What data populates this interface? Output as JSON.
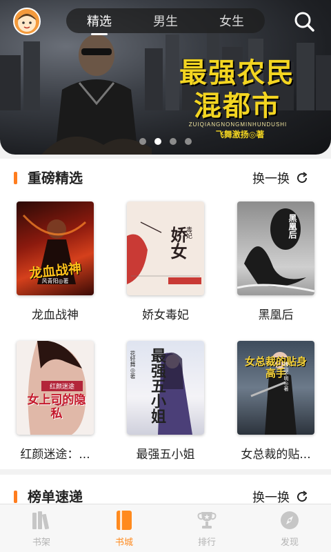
{
  "header": {
    "tabs": [
      {
        "label": "精选",
        "active": true
      },
      {
        "label": "男生",
        "active": false
      },
      {
        "label": "女生",
        "active": false
      }
    ]
  },
  "banner": {
    "title_line1": "最强农民",
    "title_line2": "混都市",
    "pinyin": "ZUIQIANGNONGMINHUNDUSHI",
    "author": "飞舞激扬◎著",
    "dots": 4,
    "active_dot": 1
  },
  "featured": {
    "title": "重磅精选",
    "refresh_label": "换一换",
    "books": [
      {
        "title": "龙血战神",
        "cover_text": "龙血战神",
        "cover_sub": "风青阳◎著"
      },
      {
        "title": "娇女毒妃",
        "cover_text": "娇女",
        "cover_sub": "毒妃"
      },
      {
        "title": "黑凰后",
        "cover_text": "黑凰后",
        "cover_sub": ""
      },
      {
        "title": "红颜迷途：...",
        "cover_text": "女上司的隐私",
        "cover_sub": "红颜迷途"
      },
      {
        "title": "最强五小姐",
        "cover_text": "最强五小姐",
        "cover_sub": "花轻舞◎著"
      },
      {
        "title": "女总裁的贴...",
        "cover_text": "女总裁的贴身高手",
        "cover_sub": "疯仙不明◎著"
      }
    ]
  },
  "ranking": {
    "title": "榜单速递",
    "refresh_label": "换一换"
  },
  "nav": {
    "items": [
      {
        "label": "书架",
        "icon": "bookshelf-icon",
        "active": false
      },
      {
        "label": "书城",
        "icon": "bookstore-icon",
        "active": true
      },
      {
        "label": "排行",
        "icon": "trophy-icon",
        "active": false
      },
      {
        "label": "发现",
        "icon": "compass-icon",
        "active": false
      }
    ]
  },
  "colors": {
    "accent": "#ff7d1f",
    "banner_title": "#f3d521"
  }
}
